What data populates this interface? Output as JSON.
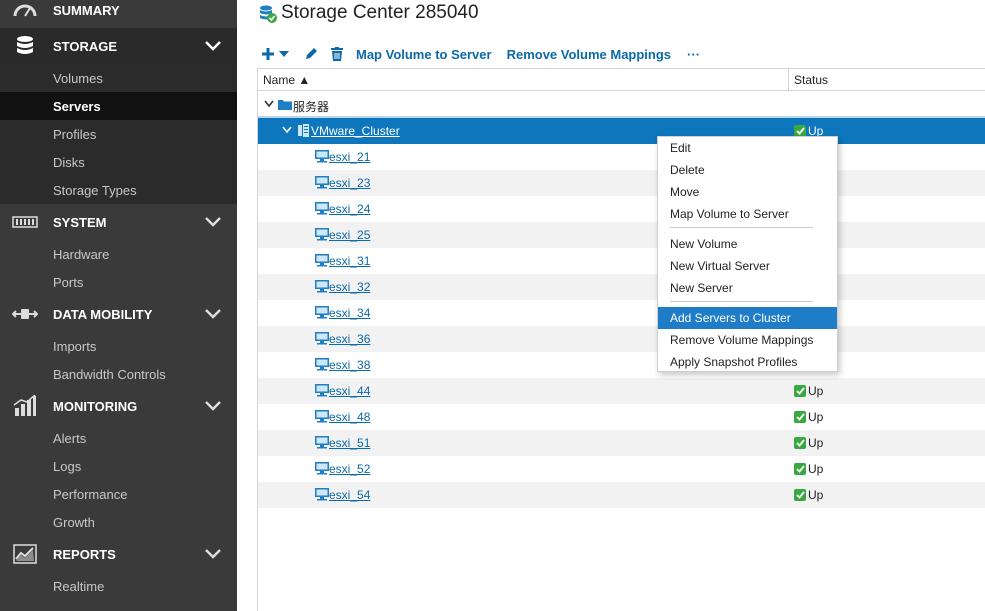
{
  "sidebar": {
    "sections": [
      {
        "label": "SUMMARY",
        "icon": "speedometer-icon",
        "items": []
      },
      {
        "label": "STORAGE",
        "icon": "database-icon",
        "items": [
          "Volumes",
          "Servers",
          "Profiles",
          "Disks",
          "Storage Types"
        ],
        "selected": "Servers"
      },
      {
        "label": "SYSTEM",
        "icon": "hardware-rack-icon",
        "items": [
          "Hardware",
          "Ports"
        ]
      },
      {
        "label": "DATA MOBILITY",
        "icon": "data-transfer-icon",
        "items": [
          "Imports",
          "Bandwidth Controls"
        ]
      },
      {
        "label": "MONITORING",
        "icon": "bar-chart-icon",
        "items": [
          "Alerts",
          "Logs",
          "Performance",
          "Growth"
        ]
      },
      {
        "label": "REPORTS",
        "icon": "line-chart-icon",
        "items": [
          "Realtime"
        ]
      }
    ]
  },
  "header": {
    "title": "Storage Center 285040",
    "title_icon": "storage-center-icon"
  },
  "toolbar": {
    "add_icon": "plus-dropdown-icon",
    "edit_icon": "pencil-icon",
    "delete_icon": "trash-icon",
    "map_volume": "Map Volume to Server",
    "remove_mappings": "Remove Volume Mappings",
    "more": "···"
  },
  "table": {
    "columns": {
      "name": "Name ▲",
      "status": "Status"
    },
    "folder": "服务器",
    "cluster": {
      "name": "VMware_Cluster",
      "status": "Up"
    },
    "servers": [
      {
        "name": "esxi_21",
        "status": ""
      },
      {
        "name": "esxi_23",
        "status": ""
      },
      {
        "name": "esxi_24",
        "status": ""
      },
      {
        "name": "esxi_25",
        "status": ""
      },
      {
        "name": "esxi_31",
        "status": ""
      },
      {
        "name": "esxi_32",
        "status": ""
      },
      {
        "name": "esxi_34",
        "status": ""
      },
      {
        "name": "esxi_36",
        "status": ""
      },
      {
        "name": "esxi_38",
        "status": ""
      },
      {
        "name": "esxi_44",
        "status": "Up"
      },
      {
        "name": "esxi_48",
        "status": "Up"
      },
      {
        "name": "esxi_51",
        "status": "Up"
      },
      {
        "name": "esxi_52",
        "status": "Up"
      },
      {
        "name": "esxi_54",
        "status": "Up"
      }
    ]
  },
  "context_menu": {
    "groups": [
      [
        "Edit",
        "Delete",
        "Move",
        "Map Volume to Server"
      ],
      [
        "New Volume",
        "New Virtual Server",
        "New Server"
      ],
      [
        "Add Servers to Cluster",
        "Remove Volume Mappings",
        "Apply Snapshot Profiles"
      ]
    ],
    "highlighted": "Add Servers to Cluster"
  },
  "colors": {
    "sidebar_bg": "#3a3a3a",
    "selected_row": "#0e76bc",
    "menu_highlight": "#1e7dc6",
    "link": "#0b6aa8",
    "status_ok": "#3aa841"
  }
}
